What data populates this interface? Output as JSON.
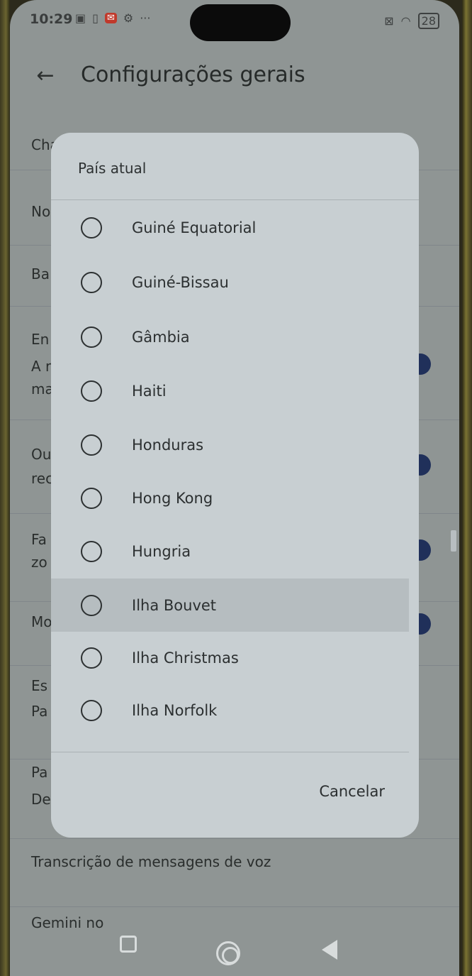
{
  "status_bar": {
    "time": "10:29",
    "icons_left": [
      "nfc-icon",
      "sim-icon",
      "mail-icon",
      "gear-icon",
      "more-dots-icon"
    ],
    "icons_right": [
      "no-sim-icon",
      "wifi-icon",
      "battery-icon"
    ],
    "battery_level": "28"
  },
  "header": {
    "back_icon": "arrow-left-icon",
    "title": "Configurações gerais"
  },
  "background_list": {
    "rows": [
      {
        "title": "Cha"
      },
      {
        "title": "No"
      },
      {
        "title": "Ba"
      },
      {
        "title": "En",
        "sub1": "A r",
        "sub2": "ma"
      },
      {
        "title": "Ou",
        "sub1": "rec"
      },
      {
        "title": "Fa",
        "sub1": "zo"
      },
      {
        "title": "Mo"
      },
      {
        "title": "Es",
        "sub1": "Pa"
      },
      {
        "title": "Pa",
        "sub1": "De"
      },
      {
        "title": "Transcrição de mensagens de voz"
      },
      {
        "title": "Gemini no"
      }
    ]
  },
  "dialog": {
    "title": "País atual",
    "options": [
      {
        "label": "Guiné Equatorial",
        "selected": false
      },
      {
        "label": "Guiné-Bissau",
        "selected": false
      },
      {
        "label": "Gâmbia",
        "selected": false
      },
      {
        "label": "Haiti",
        "selected": false
      },
      {
        "label": "Honduras",
        "selected": false
      },
      {
        "label": "Hong Kong",
        "selected": false
      },
      {
        "label": "Hungria",
        "selected": false
      },
      {
        "label": "Ilha Bouvet",
        "selected": false
      },
      {
        "label": "Ilha Christmas",
        "selected": false
      },
      {
        "label": "Ilha Norfolk",
        "selected": false
      }
    ],
    "cancel_label": "Cancelar"
  },
  "nav_bar": {
    "recent_icon": "square-recent-icon",
    "home_icon": "circle-home-icon",
    "back_icon": "triangle-back-icon"
  },
  "colors": {
    "dialog_bg": "#c8cfd2",
    "highlight_row": "#b6bdc0",
    "toggle": "#20305a"
  }
}
